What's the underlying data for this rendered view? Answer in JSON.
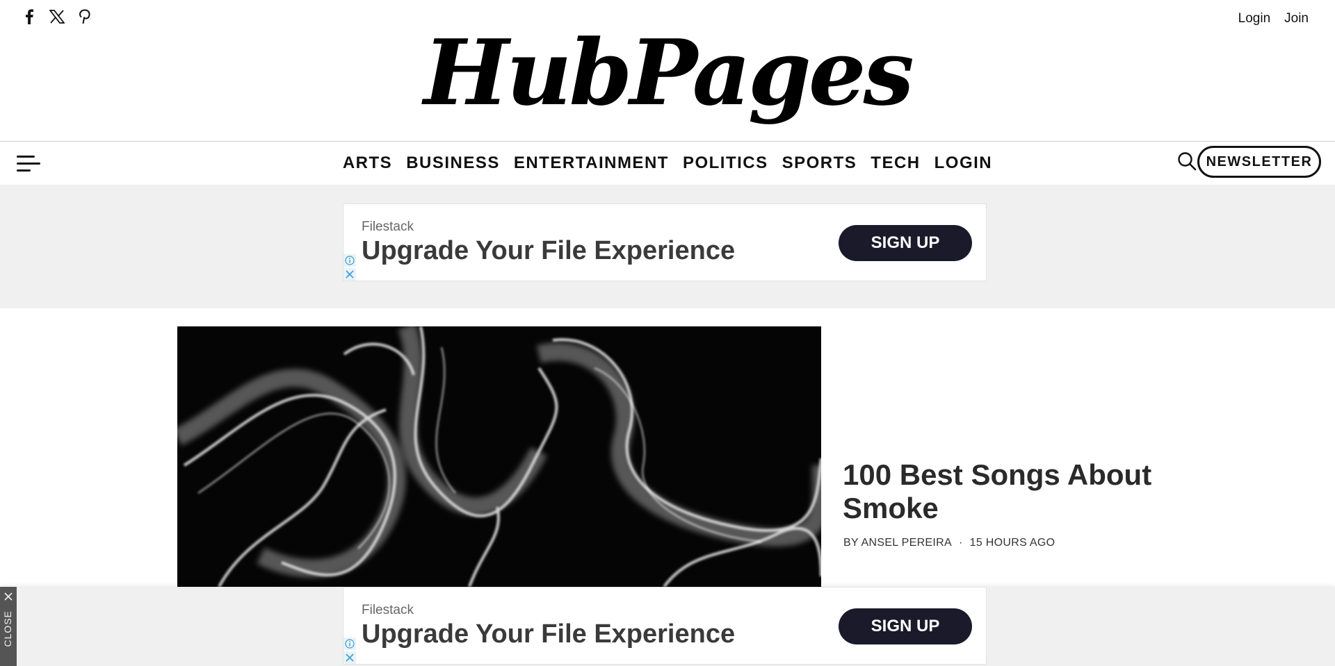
{
  "header": {
    "social": [
      {
        "name": "facebook-icon"
      },
      {
        "name": "x-twitter-icon"
      },
      {
        "name": "pinterest-icon"
      }
    ],
    "login_label": "Login",
    "join_label": "Join",
    "logo_text": "HubPages"
  },
  "nav": {
    "menu_icon": "hamburger-menu-icon",
    "items": [
      "ARTS",
      "BUSINESS",
      "ENTERTAINMENT",
      "POLITICS",
      "SPORTS",
      "TECH",
      "LOGIN"
    ],
    "search_icon": "search-icon",
    "newsletter_label": "NEWSLETTER"
  },
  "ad_top": {
    "sponsor": "Filestack",
    "headline": "Upgrade Your File Experience",
    "cta": "SIGN UP"
  },
  "feature": {
    "title": "100 Best Songs About Smoke",
    "byline": "BY ANSEL PEREIRA",
    "separator": "·",
    "time": "15 HOURS AGO"
  },
  "ad_bottom": {
    "sponsor": "Filestack",
    "headline": "Upgrade Your File Experience",
    "cta": "SIGN UP",
    "close_label": "CLOSE"
  },
  "colors": {
    "cta_bg": "#1b1a2b",
    "band_bg": "#f0f0f0",
    "text": "#111111"
  }
}
